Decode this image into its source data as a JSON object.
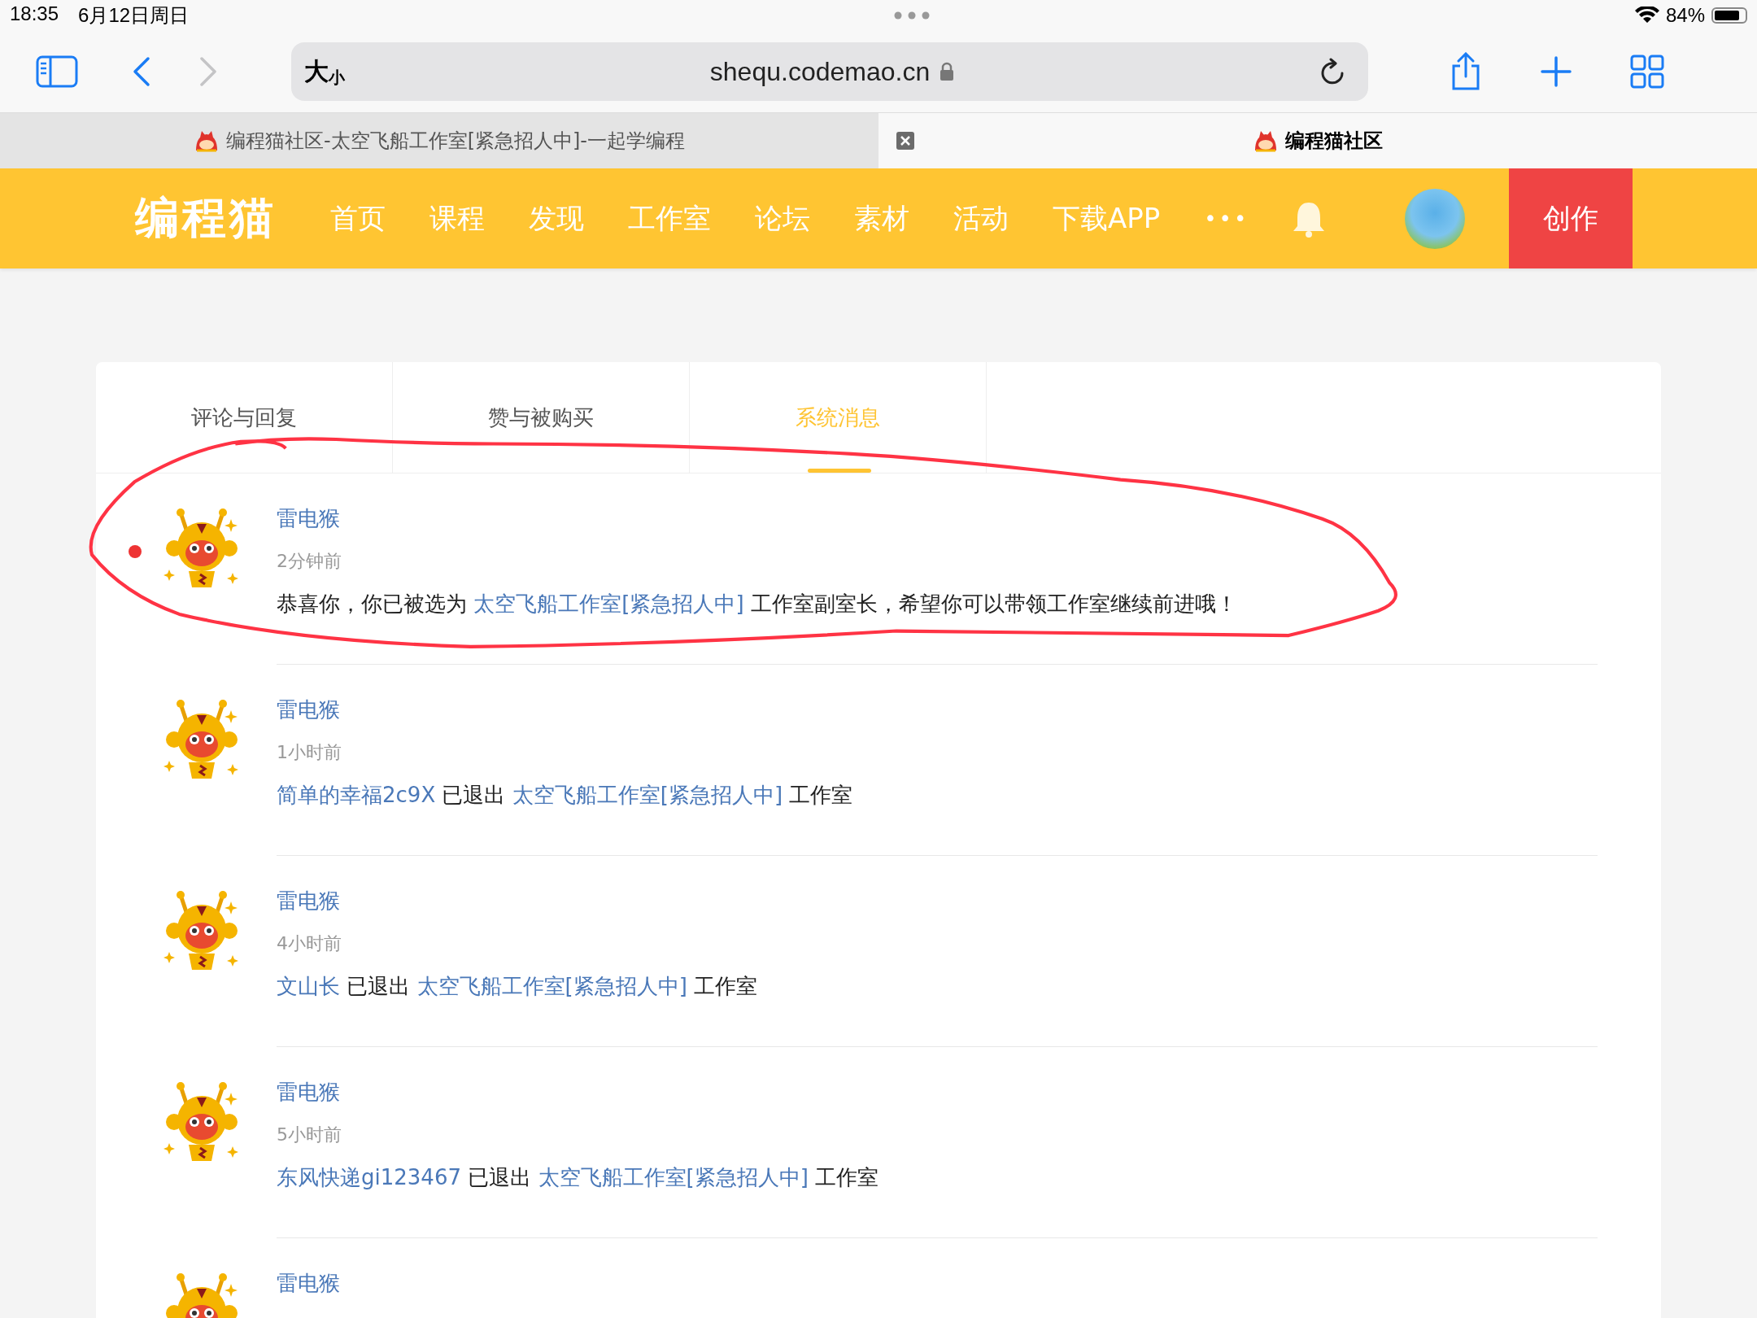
{
  "status_bar": {
    "time": "18:35",
    "date": "6月12日周日",
    "battery": "84%"
  },
  "browser": {
    "text_size_large": "大",
    "text_size_small": "小",
    "address": "shequ.codemao.cn",
    "tabs": [
      {
        "title": "编程猫社区-太空飞船工作室[紧急招人中]-一起学编程",
        "selected": false
      },
      {
        "title": "编程猫社区",
        "selected": true
      }
    ]
  },
  "nav": {
    "logo": "编程猫",
    "items": [
      "首页",
      "课程",
      "发现",
      "工作室",
      "论坛",
      "素材",
      "活动",
      "下载APP"
    ],
    "more": "•••",
    "create": "创作"
  },
  "message_tabs": [
    {
      "label": "评论与回复",
      "selected": false
    },
    {
      "label": "赞与被购买",
      "selected": false
    },
    {
      "label": "系统消息",
      "selected": true
    }
  ],
  "messages": [
    {
      "sender": "雷电猴",
      "time": "2分钟前",
      "unread": true,
      "content": [
        {
          "kind": "text",
          "text": "恭喜你，你已被选为 "
        },
        {
          "kind": "link",
          "text": "太空飞船工作室[紧急招人中]"
        },
        {
          "kind": "text",
          "text": " 工作室副室长，希望你可以带领工作室继续前进哦！"
        }
      ]
    },
    {
      "sender": "雷电猴",
      "time": "1小时前",
      "unread": false,
      "content": [
        {
          "kind": "link",
          "text": "简单的幸福2c9X"
        },
        {
          "kind": "text",
          "text": " 已退出 "
        },
        {
          "kind": "link",
          "text": "太空飞船工作室[紧急招人中]"
        },
        {
          "kind": "text",
          "text": " 工作室"
        }
      ]
    },
    {
      "sender": "雷电猴",
      "time": "4小时前",
      "unread": false,
      "content": [
        {
          "kind": "link",
          "text": "文山长"
        },
        {
          "kind": "text",
          "text": " 已退出 "
        },
        {
          "kind": "link",
          "text": "太空飞船工作室[紧急招人中]"
        },
        {
          "kind": "text",
          "text": " 工作室"
        }
      ]
    },
    {
      "sender": "雷电猴",
      "time": "5小时前",
      "unread": false,
      "content": [
        {
          "kind": "link",
          "text": "东风快递gi123467"
        },
        {
          "kind": "text",
          "text": " 已退出 "
        },
        {
          "kind": "link",
          "text": "太空飞船工作室[紧急招人中]"
        },
        {
          "kind": "text",
          "text": " 工作室"
        }
      ]
    },
    {
      "sender": "雷电猴",
      "unread": false
    }
  ]
}
